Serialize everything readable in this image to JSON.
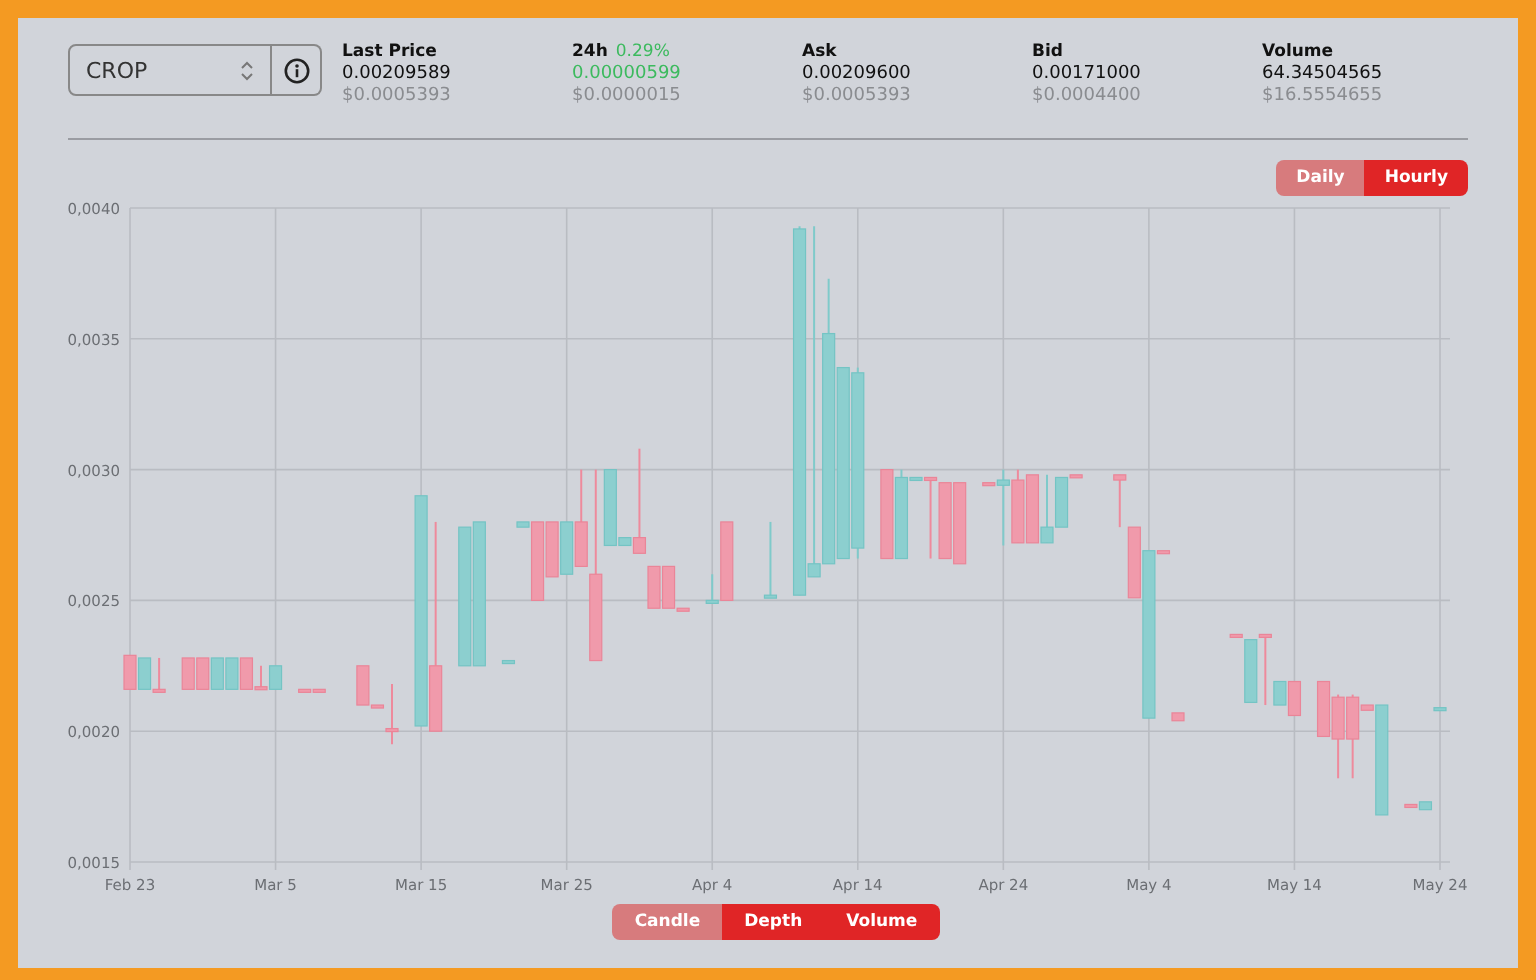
{
  "pair_select": {
    "value": "CROP"
  },
  "stats": [
    {
      "kind": "plain",
      "label": "Last Price",
      "value": "0.00209589",
      "usd": "$0.0005393"
    },
    {
      "kind": "change",
      "label": "24h",
      "change": "0.29%",
      "value": "0.00000599",
      "usd": "$0.0000015"
    },
    {
      "kind": "plain",
      "label": "Ask",
      "value": "0.00209600",
      "usd": "$0.0005393"
    },
    {
      "kind": "plain",
      "label": "Bid",
      "value": "0.00171000",
      "usd": "$0.0004400"
    },
    {
      "kind": "plain",
      "label": "Volume",
      "value": "64.34504565",
      "usd": "$16.5554655"
    }
  ],
  "interval_toggle": [
    {
      "label": "Daily",
      "selected": true
    },
    {
      "label": "Hourly",
      "selected": false
    }
  ],
  "chart": {
    "chart_data": {
      "type": "candlestick",
      "grid": true,
      "ylim": [
        0.0015,
        0.004
      ],
      "yticks": [
        {
          "value": 0.004,
          "label": "0,0040"
        },
        {
          "value": 0.0035,
          "label": "0,0035"
        },
        {
          "value": 0.003,
          "label": "0,0030"
        },
        {
          "value": 0.0025,
          "label": "0,0025"
        },
        {
          "value": 0.002,
          "label": "0,0020"
        },
        {
          "value": 0.0015,
          "label": "0,0015"
        }
      ],
      "categories": [
        "Feb 23",
        null,
        null,
        null,
        null,
        null,
        null,
        null,
        null,
        null,
        "Mar 5",
        null,
        null,
        null,
        null,
        null,
        null,
        null,
        null,
        null,
        "Mar 15",
        null,
        null,
        null,
        null,
        null,
        null,
        null,
        null,
        null,
        "Mar 25",
        null,
        null,
        null,
        null,
        null,
        null,
        null,
        null,
        null,
        "Apr 4",
        null,
        null,
        null,
        null,
        null,
        null,
        null,
        null,
        null,
        "Apr 14",
        null,
        null,
        null,
        null,
        null,
        null,
        null,
        null,
        null,
        "Apr 24",
        null,
        null,
        null,
        null,
        null,
        null,
        null,
        null,
        null,
        "May 4",
        null,
        null,
        null,
        null,
        null,
        null,
        null,
        null,
        null,
        "May 14",
        null,
        null,
        null,
        null,
        null,
        null,
        null,
        null,
        null,
        "May 24"
      ],
      "ohlc": [
        [
          0.00229,
          0.00229,
          0.00216,
          0.00216
        ],
        [
          0.00216,
          0.00228,
          0.00216,
          0.00228
        ],
        [
          0.00216,
          0.00228,
          0.00215,
          0.00215
        ],
        null,
        [
          0.00228,
          0.00228,
          0.00216,
          0.00216
        ],
        [
          0.00228,
          0.00228,
          0.00216,
          0.00216
        ],
        [
          0.00216,
          0.00228,
          0.00216,
          0.00228
        ],
        [
          0.00216,
          0.00228,
          0.00216,
          0.00228
        ],
        [
          0.00228,
          0.00228,
          0.00216,
          0.00216
        ],
        [
          0.00217,
          0.00225,
          0.00216,
          0.00216
        ],
        [
          0.00216,
          0.00225,
          0.00216,
          0.00225
        ],
        null,
        [
          0.00216,
          0.00216,
          0.00215,
          0.00215
        ],
        [
          0.00216,
          0.00216,
          0.00215,
          0.00215
        ],
        null,
        null,
        [
          0.00225,
          0.00225,
          0.0021,
          0.0021
        ],
        [
          0.0021,
          0.0021,
          0.00209,
          0.00209
        ],
        [
          0.00201,
          0.00218,
          0.00195,
          0.002
        ],
        null,
        [
          0.00202,
          0.0029,
          0.00202,
          0.0029
        ],
        [
          0.00225,
          0.0028,
          0.002,
          0.002
        ],
        null,
        [
          0.00225,
          0.00278,
          0.00225,
          0.00278
        ],
        [
          0.00225,
          0.0028,
          0.00225,
          0.0028
        ],
        null,
        [
          0.00226,
          0.00227,
          0.00226,
          0.00227
        ],
        [
          0.00278,
          0.0028,
          0.00278,
          0.0028
        ],
        [
          0.0028,
          0.0028,
          0.0025,
          0.0025
        ],
        [
          0.0028,
          0.0028,
          0.00259,
          0.00259
        ],
        [
          0.0026,
          0.0028,
          0.0026,
          0.0028
        ],
        [
          0.0028,
          0.003,
          0.00263,
          0.00263
        ],
        [
          0.0026,
          0.003,
          0.00227,
          0.00227
        ],
        [
          0.00271,
          0.003,
          0.00271,
          0.003
        ],
        [
          0.00271,
          0.00274,
          0.00271,
          0.00274
        ],
        [
          0.00274,
          0.00308,
          0.00268,
          0.00268
        ],
        [
          0.00263,
          0.00263,
          0.00247,
          0.00247
        ],
        [
          0.00263,
          0.00263,
          0.00247,
          0.00247
        ],
        [
          0.00247,
          0.00247,
          0.00246,
          0.00246
        ],
        null,
        [
          0.0025,
          0.0026,
          0.0025,
          0.0025
        ],
        [
          0.0028,
          0.0028,
          0.0025,
          0.0025
        ],
        null,
        null,
        [
          0.00251,
          0.0028,
          0.00251,
          0.00252
        ],
        null,
        [
          0.00252,
          0.00393,
          0.00252,
          0.00392
        ],
        [
          0.00259,
          0.00393,
          0.00259,
          0.00264
        ],
        [
          0.00264,
          0.00373,
          0.00264,
          0.00352
        ],
        [
          0.00266,
          0.00339,
          0.00266,
          0.00339
        ],
        [
          0.0027,
          0.00339,
          0.00266,
          0.00337
        ],
        null,
        [
          0.003,
          0.003,
          0.00266,
          0.00266
        ],
        [
          0.00266,
          0.003,
          0.00266,
          0.00297
        ],
        [
          0.00296,
          0.00297,
          0.00296,
          0.00297
        ],
        [
          0.00297,
          0.00297,
          0.00266,
          0.00296
        ],
        [
          0.00295,
          0.00295,
          0.00266,
          0.00266
        ],
        [
          0.00295,
          0.00295,
          0.00264,
          0.00264
        ],
        null,
        [
          0.00295,
          0.00295,
          0.00294,
          0.00294
        ],
        [
          0.00294,
          0.003,
          0.00271,
          0.00296
        ],
        [
          0.00296,
          0.003,
          0.00272,
          0.00272
        ],
        [
          0.00298,
          0.00298,
          0.00272,
          0.00272
        ],
        [
          0.00272,
          0.00298,
          0.00272,
          0.00278
        ],
        [
          0.00278,
          0.00297,
          0.00278,
          0.00297
        ],
        [
          0.00298,
          0.00298,
          0.00297,
          0.00297
        ],
        null,
        null,
        [
          0.00298,
          0.00298,
          0.00278,
          0.00296
        ],
        [
          0.00278,
          0.00278,
          0.00251,
          0.00251
        ],
        [
          0.00205,
          0.00269,
          0.00205,
          0.00269
        ],
        [
          0.00269,
          0.00269,
          0.00268,
          0.00268
        ],
        [
          0.00207,
          0.00207,
          0.00204,
          0.00204
        ],
        null,
        null,
        null,
        [
          0.00237,
          0.00237,
          0.00236,
          0.00236
        ],
        [
          0.00211,
          0.00235,
          0.00211,
          0.00235
        ],
        [
          0.00237,
          0.00237,
          0.0021,
          0.00236
        ],
        [
          0.0021,
          0.00219,
          0.0021,
          0.00219
        ],
        [
          0.00219,
          0.00219,
          0.00206,
          0.00206
        ],
        null,
        [
          0.00219,
          0.00219,
          0.00198,
          0.00198
        ],
        [
          0.00213,
          0.00214,
          0.00182,
          0.00197
        ],
        [
          0.00213,
          0.00214,
          0.00182,
          0.00197
        ],
        [
          0.0021,
          0.0021,
          0.00208,
          0.00208
        ],
        [
          0.00168,
          0.0021,
          0.00168,
          0.0021
        ],
        null,
        [
          0.00172,
          0.00172,
          0.00171,
          0.00171
        ],
        [
          0.0017,
          0.00173,
          0.0017,
          0.00173
        ],
        [
          0.00208,
          0.00209,
          0.00208,
          0.00209
        ]
      ]
    }
  },
  "chart_type_toggle": [
    {
      "label": "Candle",
      "selected": true
    },
    {
      "label": "Depth",
      "selected": false
    },
    {
      "label": "Volume",
      "selected": false
    }
  ]
}
